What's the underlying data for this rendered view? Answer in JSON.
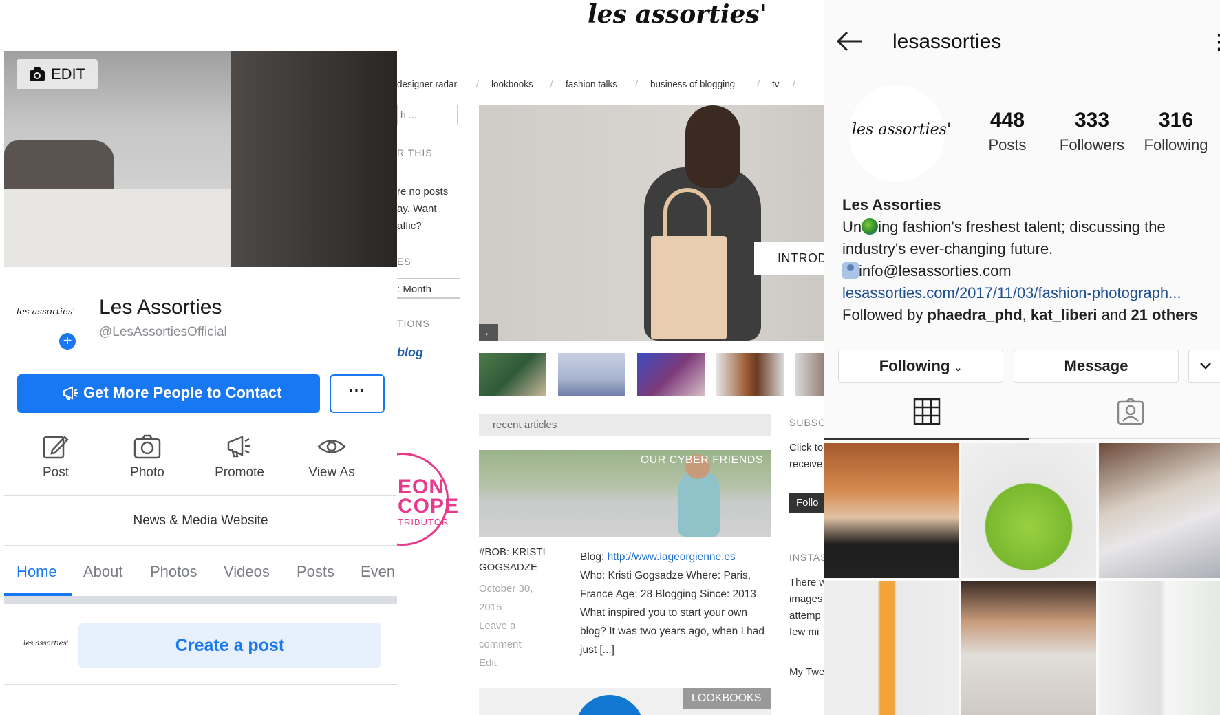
{
  "facebook": {
    "cover_edit_label": "EDIT",
    "avatar_text": "les assorties'",
    "page_name": "Les Assorties",
    "handle": "@LesAssortiesOfficial",
    "cta_label": "Get More People to Contact",
    "more_label": "···",
    "actions": [
      {
        "label": "Post",
        "icon": "edit-icon"
      },
      {
        "label": "Photo",
        "icon": "camera-icon"
      },
      {
        "label": "Promote",
        "icon": "megaphone-icon"
      },
      {
        "label": "View As",
        "icon": "eye-icon"
      }
    ],
    "category": "News & Media Website",
    "tabs": [
      "Home",
      "About",
      "Photos",
      "Videos",
      "Posts",
      "Even"
    ],
    "active_tab": "Home",
    "post_avatar_text": "les assorties'",
    "create_post_label": "Create a post",
    "accent_color": "#1877f2"
  },
  "blog": {
    "logo": "les assorties'",
    "nav": [
      "designer radar",
      "lookbooks",
      "fashion talks",
      "business of blogging",
      "tv"
    ],
    "search_placeholder": "h ...",
    "sidebar_left": {
      "head1": "R THIS",
      "text1_lines": [
        "re no posts",
        "ay. Want",
        "affic?"
      ],
      "head2": "ES",
      "select_value": ": Month",
      "head3": "TIONS",
      "blog_badge": "blog",
      "neon_line1": "EON",
      "neon_line2": "COPE",
      "neon_line3": "TRIBUTOR"
    },
    "hero_overlay": "INTRODU",
    "hero_arrow": "←",
    "recent_label": "recent articles",
    "article1": {
      "category": "OUR CYBER FRIENDS",
      "title_lines": [
        "#BOB: KRISTI",
        "GOGSADZE"
      ],
      "date_lines": [
        "October 30,",
        "2015"
      ],
      "comment_lines": [
        "Leave a",
        "comment"
      ],
      "edit_label": "Edit",
      "blog_label": "Blog: ",
      "blog_link": "http://www.lageorgienne.es",
      "body": "Who: Kristi Gogsadze Where: Paris, France Age: 28 Blogging Since: 2013 What inspired you to start your own blog? It was two years ago, when I had just [...]"
    },
    "article2": {
      "category": "LOOKBOOKS"
    },
    "sidebar_right": {
      "subscribe_head": "SUBSCR",
      "subscribe_lines": [
        "Click to",
        "receive"
      ],
      "follow_btn": "Follo",
      "insta_head": "INSTAS",
      "insta_lines": [
        "There w",
        "images",
        "attemp",
        "few mi"
      ],
      "twitter": "My Twe"
    }
  },
  "instagram": {
    "username": "lesassorties",
    "avatar_text": "les assorties'",
    "stats": [
      {
        "num": "448",
        "label": "Posts"
      },
      {
        "num": "333",
        "label": "Followers"
      },
      {
        "num": "316",
        "label": "Following"
      }
    ],
    "bio_name": "Les Assorties",
    "bio_pre": "Un",
    "bio_line1_rest": "ing fashion's freshest talent; discussing the",
    "bio_line2": "industry's ever-changing future.",
    "bio_email": "info@lesassorties.com",
    "bio_link": "lesassorties.com/2017/11/03/fashion-photograph...",
    "followed_by_pre": "Followed by ",
    "followed_user1": "phaedra_phd",
    "followed_sep": ", ",
    "followed_user2": "kat_liberi",
    "followed_and": " and ",
    "followed_others": "21 others",
    "btn_following": "Following",
    "btn_message": "Message"
  }
}
